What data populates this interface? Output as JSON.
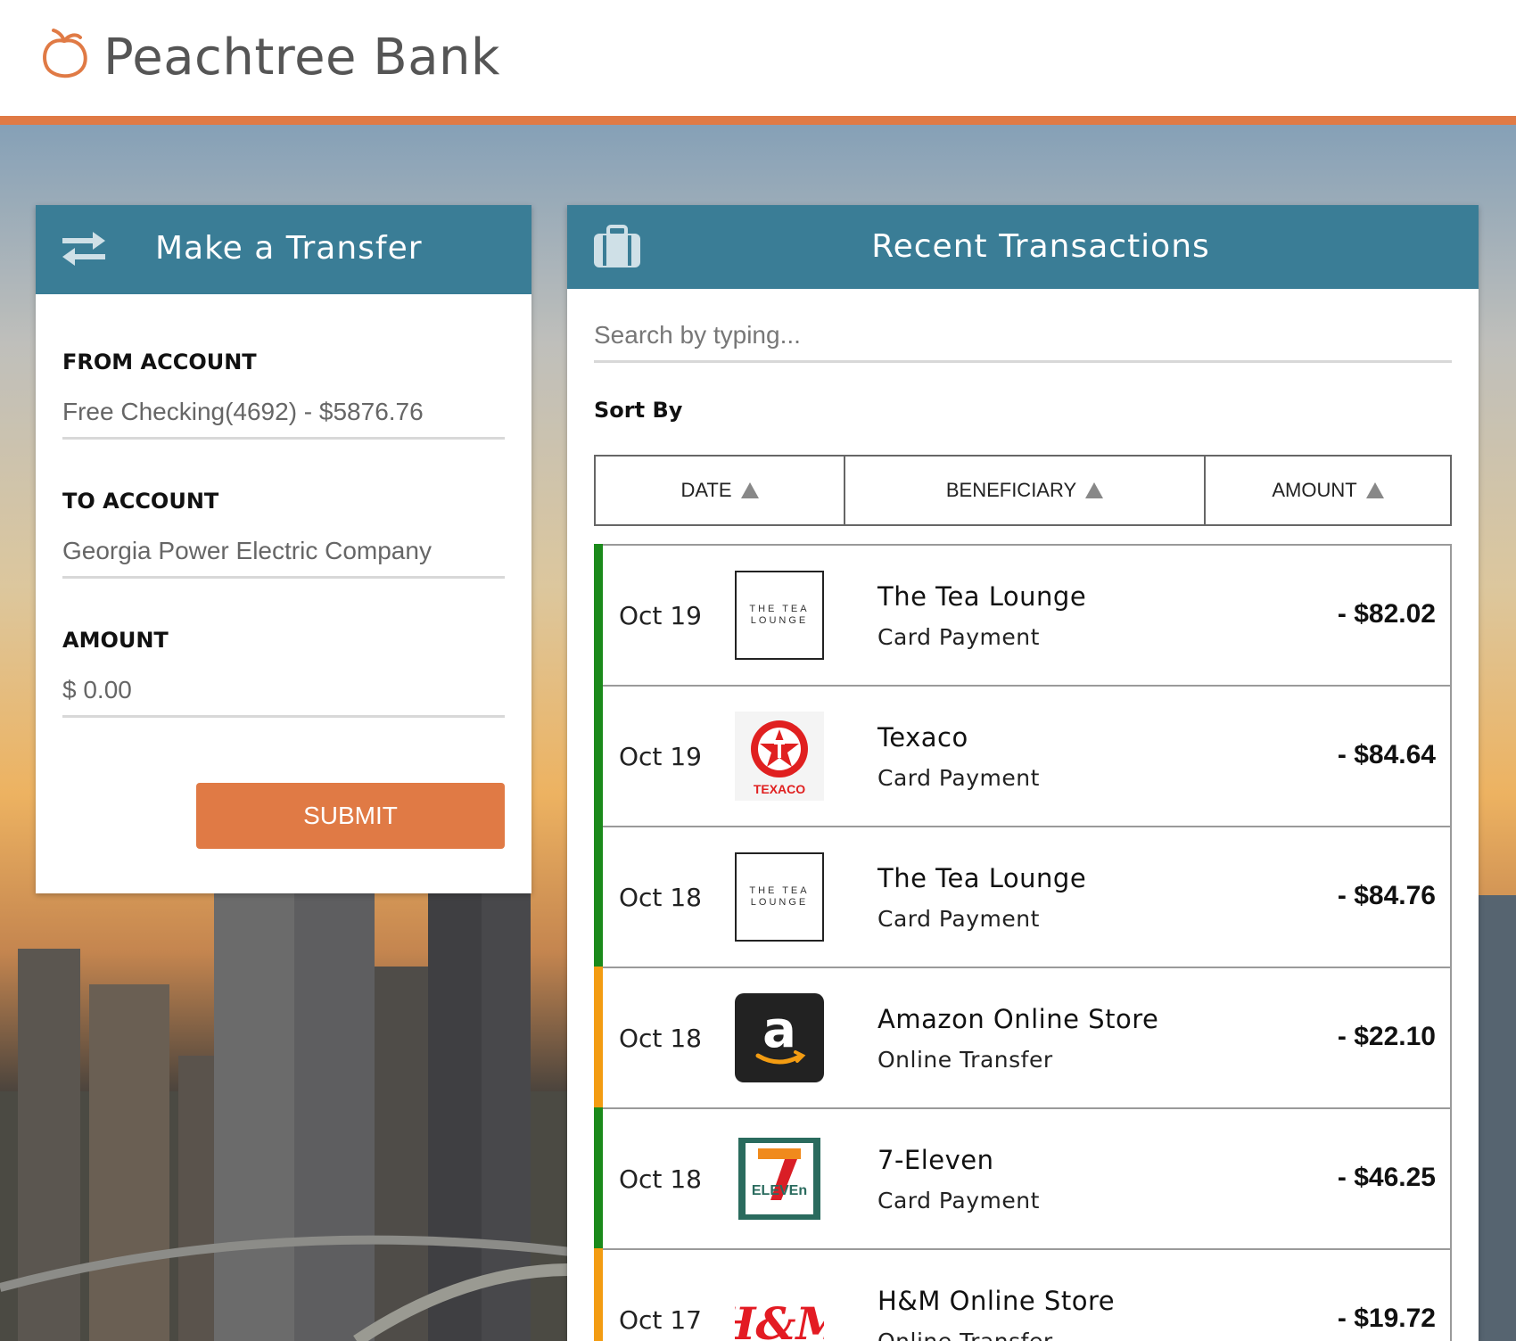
{
  "brand": {
    "name": "Peachtree Bank",
    "accent": "#e07a45",
    "primary": "#3a7d96"
  },
  "transfer": {
    "title": "Make a Transfer",
    "from_label": "FROM ACCOUNT",
    "from_value": "Free Checking(4692) - $5876.76",
    "to_label": "TO ACCOUNT",
    "to_value": "Georgia Power Electric Company",
    "amount_label": "AMOUNT",
    "amount_value": "$ 0.00",
    "submit_label": "SUBMIT"
  },
  "transactions": {
    "title": "Recent Transactions",
    "search_placeholder": "Search by typing...",
    "sort_label": "Sort By",
    "sort_options": [
      "DATE",
      "BENEFICIARY",
      "AMOUNT"
    ],
    "items": [
      {
        "date": "Oct 19",
        "merchant": "The Tea Lounge",
        "type": "Card Payment",
        "amount": "- $82.02",
        "logo": "tea-lounge-logo",
        "logo_text": "THE TEA LOUNGE",
        "status_color": "#1b8a1b"
      },
      {
        "date": "Oct 19",
        "merchant": "Texaco",
        "type": "Card Payment",
        "amount": "- $84.64",
        "logo": "texaco-logo",
        "logo_text": "TEXACO",
        "status_color": "#1b8a1b"
      },
      {
        "date": "Oct 18",
        "merchant": "The Tea Lounge",
        "type": "Card Payment",
        "amount": "- $84.76",
        "logo": "tea-lounge-logo",
        "logo_text": "THE TEA LOUNGE",
        "status_color": "#1b8a1b"
      },
      {
        "date": "Oct 18",
        "merchant": "Amazon Online Store",
        "type": "Online Transfer",
        "amount": "- $22.10",
        "logo": "amazon-logo",
        "logo_text": "a",
        "status_color": "#f39c12"
      },
      {
        "date": "Oct 18",
        "merchant": "7-Eleven",
        "type": "Card Payment",
        "amount": "- $46.25",
        "logo": "seven-eleven-logo",
        "logo_text": "ELEVEn",
        "status_color": "#1b8a1b"
      },
      {
        "date": "Oct 17",
        "merchant": "H&M Online Store",
        "type": "Online Transfer",
        "amount": "- $19.72",
        "logo": "hm-logo",
        "logo_text": "H&M",
        "status_color": "#f39c12"
      }
    ]
  }
}
